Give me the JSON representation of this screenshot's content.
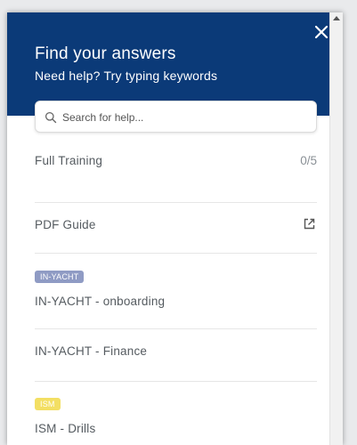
{
  "header": {
    "title": "Find your answers",
    "subtitle": "Need help? Try typing keywords",
    "close_icon": "close-icon"
  },
  "search": {
    "placeholder": "Search for help...",
    "icon": "search-icon"
  },
  "items": [
    {
      "label": "Full Training",
      "count": "0/5"
    },
    {
      "label": "PDF Guide",
      "icon": "external-link-icon"
    },
    {
      "badge": "IN-YACHT",
      "label": "IN-YACHT - onboarding"
    },
    {
      "label": "IN-YACHT - Finance"
    },
    {
      "badge": "ISM",
      "label": "ISM - Drills"
    }
  ],
  "colors": {
    "header_bg": "#0b3a78",
    "yacht_badge": "#8f9bc4",
    "ism_badge": "#f3df63"
  }
}
